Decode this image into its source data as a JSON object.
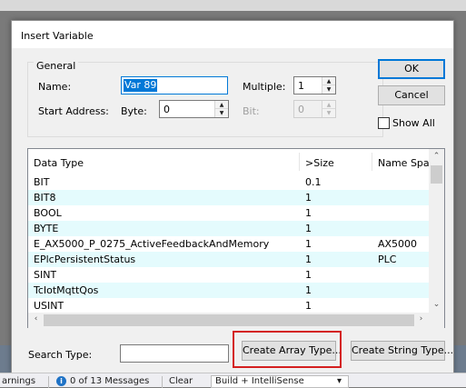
{
  "dialog": {
    "title": "Insert Variable"
  },
  "general": {
    "legend": "General",
    "name_label": "Name:",
    "name_value": "Var 89",
    "multiple_label": "Multiple:",
    "multiple_value": "1",
    "start_address_label": "Start Address:",
    "byte_label": "Byte:",
    "byte_value": "0",
    "bit_label": "Bit:",
    "bit_value": "0"
  },
  "buttons": {
    "ok": "OK",
    "cancel": "Cancel",
    "show_all": "Show All",
    "create_array": "Create Array Type...",
    "create_string": "Create String Type..."
  },
  "search": {
    "label": "Search Type:",
    "value": ""
  },
  "table": {
    "columns": [
      "Data Type",
      ">Size",
      "Name Spac"
    ],
    "rows": [
      {
        "type": "BIT",
        "size": "0.1",
        "ns": ""
      },
      {
        "type": "BIT8",
        "size": "1",
        "ns": ""
      },
      {
        "type": "BOOL",
        "size": "1",
        "ns": ""
      },
      {
        "type": "BYTE",
        "size": "1",
        "ns": ""
      },
      {
        "type": "E_AX5000_P_0275_ActiveFeedbackAndMemory",
        "size": "1",
        "ns": "AX5000"
      },
      {
        "type": "EPlcPersistentStatus",
        "size": "1",
        "ns": "PLC"
      },
      {
        "type": "SINT",
        "size": "1",
        "ns": ""
      },
      {
        "type": "TcIotMqttQos",
        "size": "1",
        "ns": ""
      },
      {
        "type": "USINT",
        "size": "1",
        "ns": ""
      }
    ]
  },
  "taskbar": {
    "warnings": "arnings",
    "messages": "0 of 13 Messages",
    "clear": "Clear",
    "build_filter": "Build + IntelliSense"
  },
  "colors": {
    "accent": "#0078d7",
    "row_alt": "#e4fbfd",
    "highlight": "#d41f1f"
  }
}
